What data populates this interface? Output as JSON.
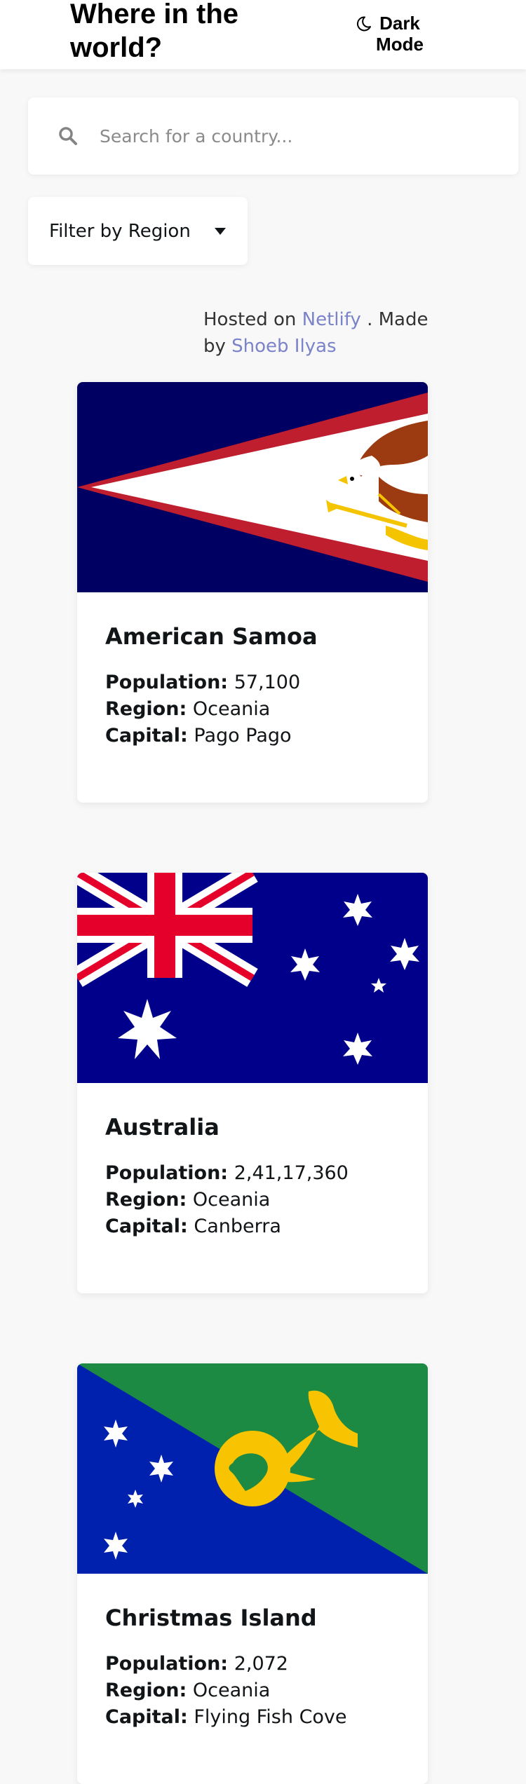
{
  "header": {
    "title": "Where in the world?",
    "theme_toggle_label": "Dark Mode"
  },
  "search": {
    "placeholder": "Search for a country...",
    "value": ""
  },
  "filter": {
    "label": "Filter by Region"
  },
  "attribution": {
    "prefix": "Hosted on",
    "host_link": "Netlify",
    "middle": ". Made by",
    "author_link": "Shoeb Ilyas"
  },
  "labels": {
    "population": "Population:",
    "region": "Region:",
    "capital": "Capital:"
  },
  "countries": [
    {
      "name": "American Samoa",
      "population": "57,100",
      "region": "Oceania",
      "capital": "Pago Pago",
      "flag_icon": "american-samoa-flag"
    },
    {
      "name": "Australia",
      "population": "2,41,17,360",
      "region": "Oceania",
      "capital": "Canberra",
      "flag_icon": "australia-flag"
    },
    {
      "name": "Christmas Island",
      "population": "2,072",
      "region": "Oceania",
      "capital": "Flying Fish Cove",
      "flag_icon": "christmas-island-flag"
    }
  ],
  "colors": {
    "background": "#f8f8f8",
    "card": "#ffffff",
    "text": "#111517",
    "link": "#7b83c9"
  }
}
